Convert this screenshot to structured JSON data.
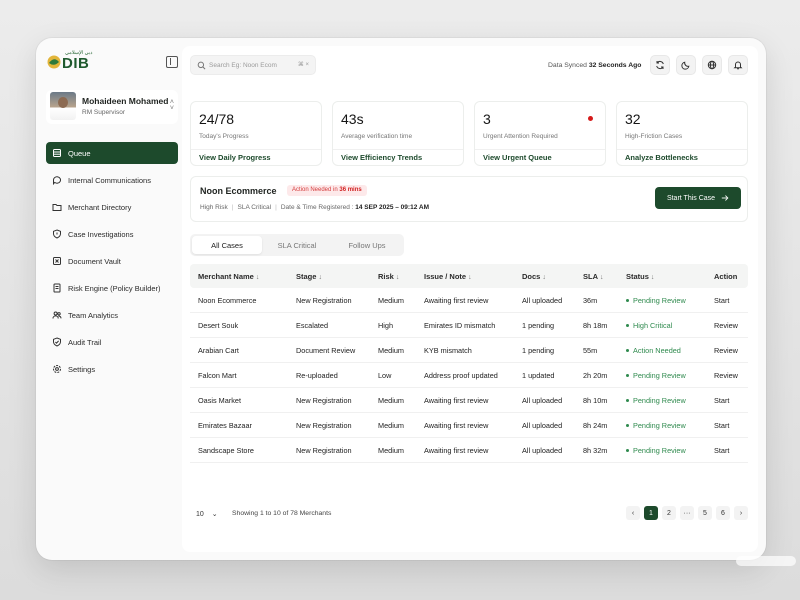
{
  "brand": {
    "name": "DIB",
    "arabic": "دبي الإسلامي"
  },
  "user": {
    "name": "Mohaideen Mohamed",
    "role": "RM Supervisor"
  },
  "nav": [
    {
      "id": "queue",
      "label": "Queue",
      "active": true
    },
    {
      "id": "internal-communications",
      "label": "Internal Communications"
    },
    {
      "id": "merchant-directory",
      "label": "Merchant Directory"
    },
    {
      "id": "case-investigations",
      "label": "Case Investigations"
    },
    {
      "id": "document-vault",
      "label": "Document Vault"
    },
    {
      "id": "risk-engine",
      "label": "Risk Engine (Policy Builder)"
    },
    {
      "id": "team-analytics",
      "label": "Team Analytics"
    },
    {
      "id": "audit-trail",
      "label": "Audit Trail"
    },
    {
      "id": "settings",
      "label": "Settings"
    }
  ],
  "search": {
    "placeholder": "Search Eg: Noon Ecom",
    "shortcut": "⌘ ×"
  },
  "sync": {
    "prefix": "Data Synced",
    "value": "32 Seconds Ago"
  },
  "stats": [
    {
      "value": "24/78",
      "label": "Today's Progress",
      "link": "View Daily Progress"
    },
    {
      "value": "43s",
      "label": "Average verification time",
      "link": "View Efficiency Trends"
    },
    {
      "value": "3",
      "label": "Urgent Attention Required",
      "link": "View Urgent Queue"
    },
    {
      "value": "32",
      "label": "High-Friction Cases",
      "link": "Analyze Bottlenecks"
    }
  ],
  "current_case": {
    "title": "Noon Ecommerce",
    "badge_prefix": "Action Needed in",
    "badge_time": "36 mins",
    "risk": "High Risk",
    "sla": "SLA Critical",
    "registered_label": "Date & Time Registered :",
    "registered_value": "14 SEP 2025 – 09:12 AM",
    "action": "Start This Case"
  },
  "tabs": [
    "All Cases",
    "SLA Critical",
    "Follow Ups"
  ],
  "table": {
    "headers": [
      "Merchant Name",
      "Stage",
      "Risk",
      "Issue / Note",
      "Docs",
      "SLA",
      "Status",
      "Action"
    ],
    "rows": [
      [
        "Noon Ecommerce",
        "New Registration",
        "Medium",
        "Awaiting first review",
        "All uploaded",
        "36m",
        "Pending Review",
        "Start"
      ],
      [
        "Desert Souk",
        "Escalated",
        "High",
        "Emirates ID mismatch",
        "1 pending",
        "8h 18m",
        "High Critical",
        "Review"
      ],
      [
        "Arabian Cart",
        "Document Review",
        "Medium",
        "KYB mismatch",
        "1 pending",
        "55m",
        "Action Needed",
        "Review"
      ],
      [
        "Falcon Mart",
        "Re-uploaded",
        "Low",
        "Address proof updated",
        "1 updated",
        "2h 20m",
        "Pending Review",
        "Review"
      ],
      [
        "Oasis Market",
        "New Registration",
        "Medium",
        "Awaiting first review",
        "All uploaded",
        "8h 10m",
        "Pending Review",
        "Start"
      ],
      [
        "Emirates Bazaar",
        "New Registration",
        "Medium",
        "Awaiting first review",
        "All uploaded",
        "8h 24m",
        "Pending Review",
        "Start"
      ],
      [
        "Sandscape Store",
        "New Registration",
        "Medium",
        "Awaiting first review",
        "All uploaded",
        "8h 32m",
        "Pending Review",
        "Start"
      ]
    ]
  },
  "footer": {
    "page_size": "10",
    "showing": "Showing 1 to 10 of 78 Merchants",
    "pages": [
      "‹",
      "1",
      "2",
      "···",
      "5",
      "6",
      "›"
    ],
    "current_page": "1"
  },
  "colors": {
    "brand": "#1d4a2c",
    "status_green": "#2f8a4e",
    "alert_red": "#d12020"
  }
}
